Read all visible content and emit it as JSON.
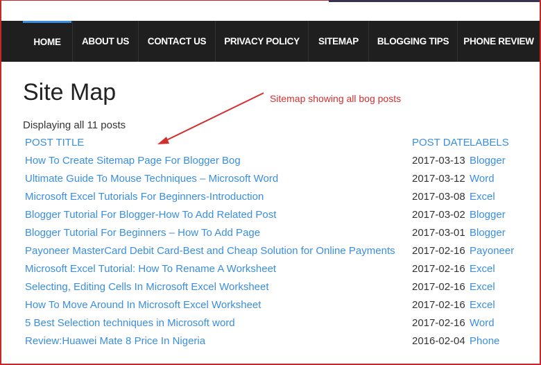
{
  "nav": {
    "items": [
      {
        "label": "HOME",
        "active": true
      },
      {
        "label": "ABOUT US"
      },
      {
        "label": "CONTACT US"
      },
      {
        "label": "PRIVACY POLICY"
      },
      {
        "label": "SITEMAP"
      },
      {
        "label": "BLOGGING TIPS"
      },
      {
        "label": "PHONE REVIEW"
      }
    ]
  },
  "page": {
    "title": "Site Map",
    "annotation": "Sitemap showing all bog posts",
    "count_text": "Displaying all 11 posts"
  },
  "table": {
    "headers": {
      "title": "POST TITLE",
      "date": "POST DATE",
      "labels": "LABELS"
    },
    "rows": [
      {
        "title": "How To Create Sitemap Page For Blogger Bog",
        "date": "2017-03-13",
        "label": "Blogger"
      },
      {
        "title": "Ultimate Guide To Mouse Techniques – Microsoft Word",
        "date": "2017-03-12",
        "label": "Word"
      },
      {
        "title": "Microsoft Excel Tutorials For Beginners-Introduction",
        "date": "2017-03-08",
        "label": "Excel"
      },
      {
        "title": "Blogger Tutorial For Blogger-How To Add Related Post",
        "date": "2017-03-02",
        "label": "Blogger"
      },
      {
        "title": "Blogger Tutorial For Beginners – How To Add Page",
        "date": "2017-03-01",
        "label": "Blogger"
      },
      {
        "title": "Payoneer MasterCard Debit Card-Best and Cheap Solution for Online Payments",
        "date": "2017-02-16",
        "label": "Payoneer"
      },
      {
        "title": "Microsoft Excel Tutorial: How To Rename A Worksheet",
        "date": "2017-02-16",
        "label": "Excel"
      },
      {
        "title": "Selecting, Editing Cells In Microsoft Excel Worksheet",
        "date": "2017-02-16",
        "label": "Excel"
      },
      {
        "title": "How To Move Around In Microsoft Excel Worksheet",
        "date": "2017-02-16",
        "label": "Excel"
      },
      {
        "title": "5 Best Selection techniques in Microsoft word",
        "date": "2017-02-16",
        "label": "Word"
      },
      {
        "title": "Review:Huawei Mate 8 Price In Nigeria",
        "date": "2016-02-04",
        "label": "Phone"
      }
    ]
  },
  "colors": {
    "nav_bg": "#1f1f1f",
    "accent": "#3a8ee0",
    "annotation": "#d32f2f"
  }
}
